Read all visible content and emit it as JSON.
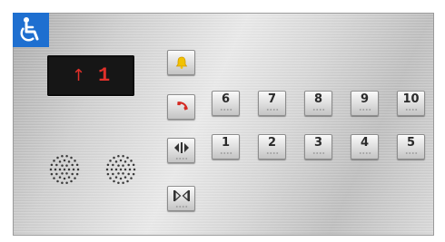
{
  "display": {
    "direction_arrow": "↑",
    "floor": "1"
  },
  "icons": {
    "accessibility": "wheelchair-icon",
    "alarm": "bell-icon",
    "phone": "phone-icon",
    "door_open": "door-open-icon",
    "door_close": "door-close-icon"
  },
  "colors": {
    "accessibility_blue": "#1e6fd0",
    "display_red": "#e0302a",
    "alarm_yellow": "#f2c200",
    "phone_red": "#d42a22"
  },
  "floor_buttons": {
    "top_row": [
      "6",
      "7",
      "8",
      "9",
      "10"
    ],
    "bottom_row": [
      "1",
      "2",
      "3",
      "4",
      "5"
    ]
  }
}
